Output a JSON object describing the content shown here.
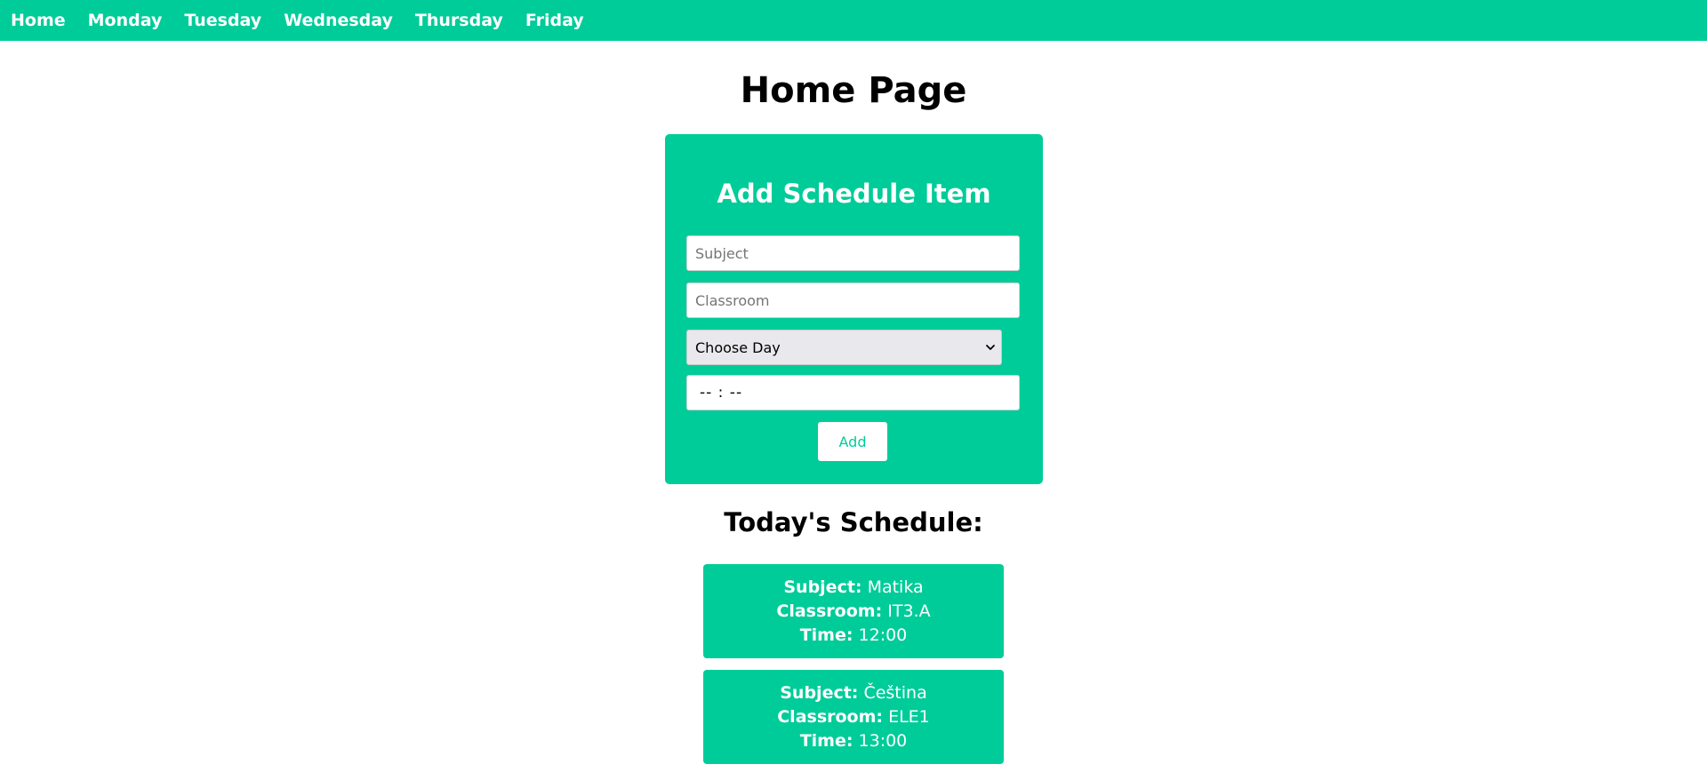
{
  "nav": {
    "items": [
      {
        "label": "Home"
      },
      {
        "label": "Monday"
      },
      {
        "label": "Tuesday"
      },
      {
        "label": "Wednesday"
      },
      {
        "label": "Thursday"
      },
      {
        "label": "Friday"
      }
    ]
  },
  "page": {
    "title": "Home Page"
  },
  "form": {
    "title": "Add Schedule Item",
    "subject_placeholder": "Subject",
    "classroom_placeholder": "Classroom",
    "day_select_value": "Choose Day",
    "time_value": "-- : --",
    "add_label": "Add"
  },
  "schedule": {
    "heading": "Today's Schedule:",
    "subject_label": "Subject:",
    "classroom_label": "Classroom:",
    "time_label": "Time:",
    "items": [
      {
        "subject": "Matika",
        "classroom": "IT3.A",
        "time": "12:00"
      },
      {
        "subject": "Čeština",
        "classroom": "ELE1",
        "time": "13:00"
      }
    ]
  },
  "colors": {
    "accent": "#00cc99",
    "text": "#000000",
    "background": "#ffffff"
  }
}
